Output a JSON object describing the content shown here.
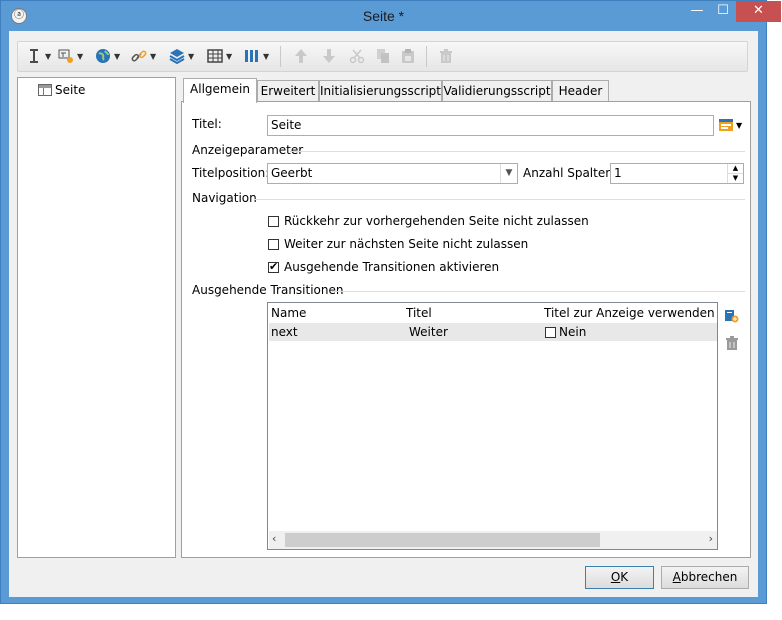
{
  "window": {
    "title": "Seite *",
    "minimize": "—",
    "maximize": "☐",
    "close": "✕"
  },
  "tree": {
    "items": [
      {
        "label": "Seite"
      }
    ]
  },
  "tabs": [
    "Allgemein",
    "Erweitert",
    "Initialisierungsscript",
    "Validierungsscript",
    "Header"
  ],
  "general": {
    "title_label": "Titel:",
    "title_value": "Seite",
    "display_params": "Anzeigeparameter",
    "title_position_label": "Titelposition:",
    "title_position_value": "Geerbt",
    "columns_label": "Anzahl Spalten:",
    "columns_value": "1",
    "navigation": "Navigation",
    "nav_options": [
      {
        "label": "Rückkehr zur vorhergehenden Seite nicht zulassen",
        "checked": false
      },
      {
        "label": "Weiter zur nächsten Seite nicht zulassen",
        "checked": false
      },
      {
        "label": "Ausgehende Transitionen aktivieren",
        "checked": true
      }
    ],
    "transitions_section": "Ausgehende Transitionen",
    "columns": [
      "Name",
      "Titel",
      "Titel zur Anzeige verwenden"
    ],
    "rows": [
      {
        "name": "next",
        "title": "Weiter",
        "use_label": "Nein",
        "use_checked": false
      }
    ]
  },
  "buttons": {
    "ok": "OK",
    "ok_mnemonic": "O",
    "ok_rest": "K",
    "cancel_mnemonic": "A",
    "cancel_rest": "bbrechen"
  },
  "colors": {
    "titlebar": "#5b9bd5",
    "close": "#c75050",
    "toolbar_icon": "#2b73b7"
  }
}
